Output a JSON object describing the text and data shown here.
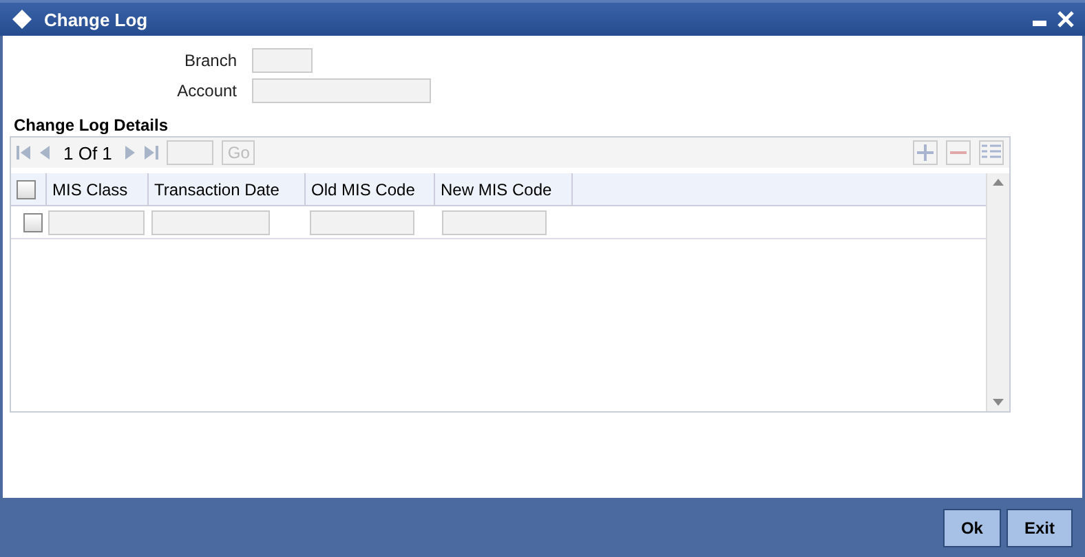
{
  "window": {
    "title": "Change Log"
  },
  "fields": [
    {
      "label": "Branch"
    },
    {
      "label": "Account"
    }
  ],
  "section": {
    "title": "Change Log Details"
  },
  "pager": {
    "text": "1 Of 1",
    "go": "Go",
    "go_disabled": true
  },
  "table": {
    "select_all": {
      "checked": false
    },
    "columns": [
      "MIS Class",
      "Transaction Date",
      "Old MIS Code",
      "New MIS Code"
    ],
    "rows": [
      {
        "checked": false
      }
    ]
  },
  "buttons": [
    "Ok",
    "Exit"
  ]
}
